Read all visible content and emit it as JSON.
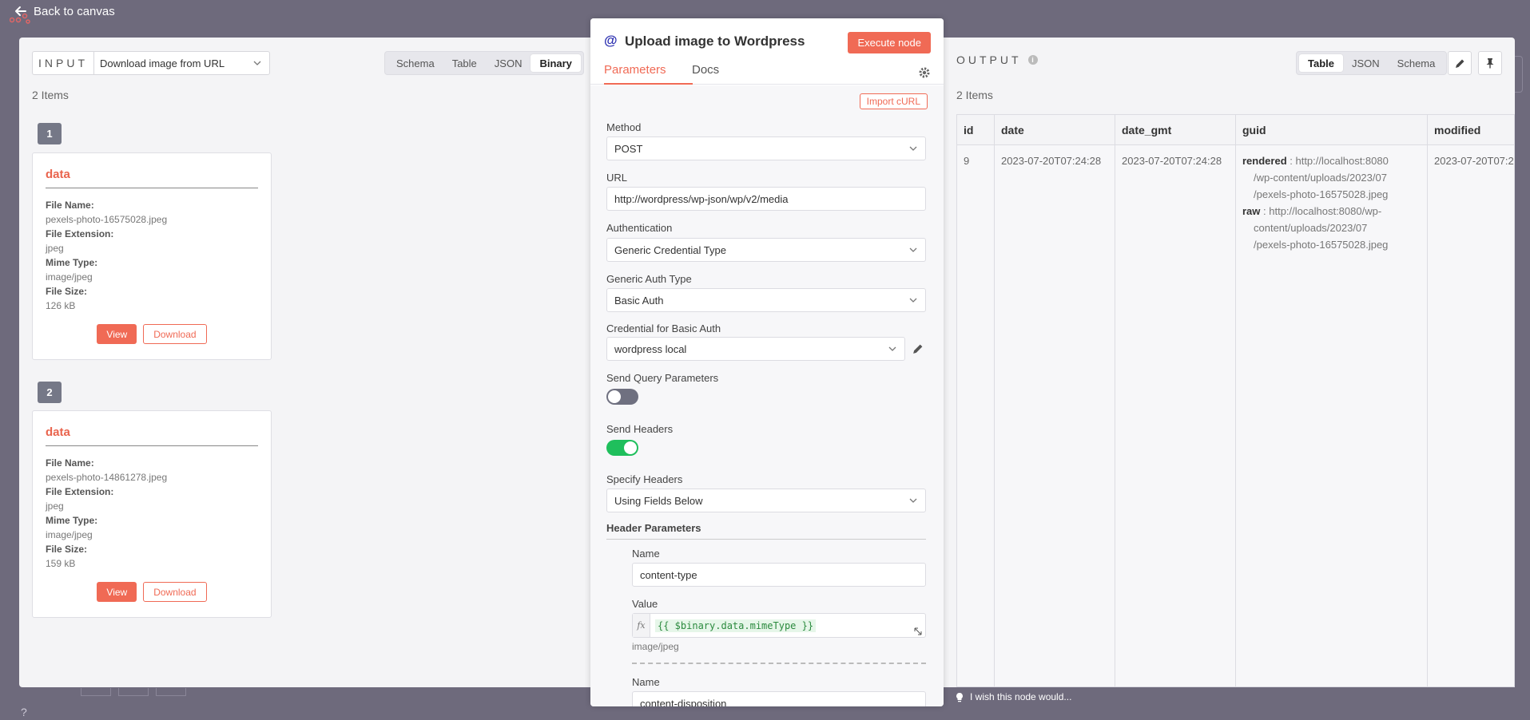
{
  "top": {
    "back_label": "Back to canvas",
    "help_glyph": "?"
  },
  "input": {
    "label": "INPUT",
    "source_node": "Download image from URL",
    "views": [
      "Schema",
      "Table",
      "JSON",
      "Binary"
    ],
    "active_view": "Binary",
    "items_count": "2 Items",
    "items": [
      {
        "index": "1",
        "title": "data",
        "file_name_key": "File Name:",
        "file_name": "pexels-photo-16575028.jpeg",
        "file_ext_key": "File Extension:",
        "file_ext": "jpeg",
        "mime_key": "Mime Type:",
        "mime": "image/jpeg",
        "size_key": "File Size:",
        "size": "126 kB",
        "view_label": "View",
        "download_label": "Download"
      },
      {
        "index": "2",
        "title": "data",
        "file_name_key": "File Name:",
        "file_name": "pexels-photo-14861278.jpeg",
        "file_ext_key": "File Extension:",
        "file_ext": "jpeg",
        "mime_key": "Mime Type:",
        "mime": "image/jpeg",
        "size_key": "File Size:",
        "size": "159 kB",
        "view_label": "View",
        "download_label": "Download"
      }
    ]
  },
  "node": {
    "title": "Upload image to Wordpress",
    "icon": "@",
    "execute_label": "Execute node",
    "tabs": [
      "Parameters",
      "Docs"
    ],
    "active_tab": "Parameters",
    "import_curl": "Import cURL",
    "method_label": "Method",
    "method": "POST",
    "url_label": "URL",
    "url": "http://wordpress/wp-json/wp/v2/media",
    "auth_label": "Authentication",
    "auth": "Generic Credential Type",
    "auth_type_label": "Generic Auth Type",
    "auth_type": "Basic Auth",
    "credential_label": "Credential for Basic Auth",
    "credential": "wordpress local",
    "send_query_label": "Send Query Parameters",
    "send_query": false,
    "send_headers_label": "Send Headers",
    "send_headers": true,
    "specify_headers_label": "Specify Headers",
    "specify_headers": "Using Fields Below",
    "header_params_title": "Header Parameters",
    "headers": [
      {
        "name_label": "Name",
        "name": "content-type",
        "value_label": "Value",
        "value_expr": "{{ $binary.data.mimeType }}",
        "value_result": "image/jpeg"
      },
      {
        "name_label": "Name",
        "name": "content-disposition"
      }
    ],
    "fx_glyph": "fx"
  },
  "output": {
    "label": "OUTPUT",
    "views": [
      "Table",
      "JSON",
      "Schema"
    ],
    "active_view": "Table",
    "items_count": "2 Items",
    "columns": [
      "id",
      "date",
      "date_gmt",
      "guid",
      "modified"
    ],
    "row": {
      "id": "9",
      "date": "2023-07-20T07:24:28",
      "date_gmt": "2023-07-20T07:24:28",
      "guid_rendered_key": "rendered",
      "guid_rendered_1": " : http://localhost:8080",
      "guid_rendered_2": "/wp-content/uploads/2023/07",
      "guid_rendered_3": "/pexels-photo-16575028.jpeg",
      "guid_raw_key": "raw",
      "guid_raw_1": " : http://localhost:8080/wp-",
      "guid_raw_2": "content/uploads/2023/07",
      "guid_raw_3": "/pexels-photo-16575028.jpeg",
      "modified": "2023-07-20T07:2"
    }
  },
  "footer": {
    "wish": "I wish this node would..."
  },
  "colors": {
    "accent": "#f06a55",
    "toggle_on": "#1fbf5c",
    "toggle_off": "#6f7080",
    "node_icon": "#2b2fb0"
  }
}
